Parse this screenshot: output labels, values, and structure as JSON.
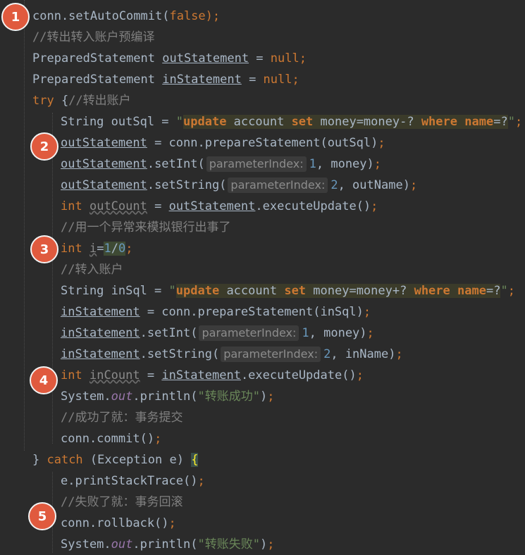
{
  "code": {
    "l1": {
      "a": "conn.setAutoCommit(",
      "b": "false",
      "c": ");"
    },
    "l2": {
      "a": "//转出转入账户预编译"
    },
    "l3": {
      "a": "PreparedStatement ",
      "b": "outStatement",
      "c": " = ",
      "d": "null",
      "e": ";"
    },
    "l4": {
      "a": "PreparedStatement ",
      "b": "inStatement",
      "c": " = ",
      "d": "null",
      "e": ";"
    },
    "l5": {
      "a": "try",
      "b": " {",
      "c": "//转出账户"
    },
    "l6": {
      "a": "String outSql = ",
      "b": "\"",
      "c": "update",
      "d": " account ",
      "e": "set",
      "f": " money=money-? ",
      "g": "where",
      "h": " ",
      "i": "name",
      "j": "=?",
      "k": "\"",
      "l": ";"
    },
    "l7": {
      "a": "outStatement",
      "b": " = conn.prepareStatement(outSql)",
      "c": ";"
    },
    "l8": {
      "a": "outStatement",
      "b": ".setInt(",
      "hint": "parameterIndex:",
      "c": "1",
      "d": ", money)",
      "e": ";"
    },
    "l9": {
      "a": "outStatement",
      "b": ".setString(",
      "hint": "parameterIndex:",
      "c": "2",
      "d": ", outName)",
      "e": ";"
    },
    "l10": {
      "a": "int",
      "b": " ",
      "c": "outCount",
      "d": " = ",
      "e": "outStatement",
      "f": ".executeUpdate()",
      "g": ";"
    },
    "l11": {
      "a": "//用一个异常来模拟银行出事了"
    },
    "l12": {
      "a": "int",
      "b": " ",
      "c": "i",
      "d": "=",
      "e": "1",
      "f": "/",
      "g": "0",
      "h": ";"
    },
    "l13": {
      "a": "//转入账户"
    },
    "l14": {
      "a": "String inSql = ",
      "b": "\"",
      "c": "update",
      "d": " account ",
      "e": "set",
      "f": " money=money+? ",
      "g": "where",
      "h": " ",
      "i": "name",
      "j": "=?",
      "k": "\"",
      "l": ";"
    },
    "l15": {
      "a": "inStatement",
      "b": " = conn.prepareStatement(inSql)",
      "c": ";"
    },
    "l16": {
      "a": "inStatement",
      "b": ".setInt(",
      "hint": "parameterIndex:",
      "c": "1",
      "d": ", money)",
      "e": ";"
    },
    "l17": {
      "a": "inStatement",
      "b": ".setString(",
      "hint": "parameterIndex:",
      "c": "2",
      "d": ", inName)",
      "e": ";"
    },
    "l18": {
      "a": "int",
      "b": " ",
      "c": "inCount",
      "d": " = ",
      "e": "inStatement",
      "f": ".executeUpdate()",
      "g": ";"
    },
    "l19": {
      "a": "System.",
      "b": "out",
      "c": ".println(",
      "d": "\"转账成功\"",
      "e": ")",
      "f": ";"
    },
    "l20": {
      "a": "//成功了就：事务提交"
    },
    "l21": {
      "a": "conn.commit()",
      "b": ";"
    },
    "l22": {
      "a": "} ",
      "b": "catch",
      "c": " (Exception e) ",
      "d": "{"
    },
    "l23": {
      "a": "e.printStackTrace()",
      "b": ";"
    },
    "l24": {
      "a": "//失败了就：事务回滚"
    },
    "l25": {
      "a": "conn.rollback()",
      "b": ";"
    },
    "l26": {
      "a": "System.",
      "b": "out",
      "c": ".println(",
      "d": "\"转账失败\"",
      "e": ")",
      "f": ";"
    }
  },
  "badges": [
    "1",
    "2",
    "3",
    "4",
    "5"
  ],
  "colors": {
    "background": "#2b2b2b",
    "keyword": "#cc7832",
    "comment": "#808080",
    "string": "#6a8759",
    "number": "#6897bb",
    "field": "#9876aa",
    "badge": "#e05a3e"
  }
}
